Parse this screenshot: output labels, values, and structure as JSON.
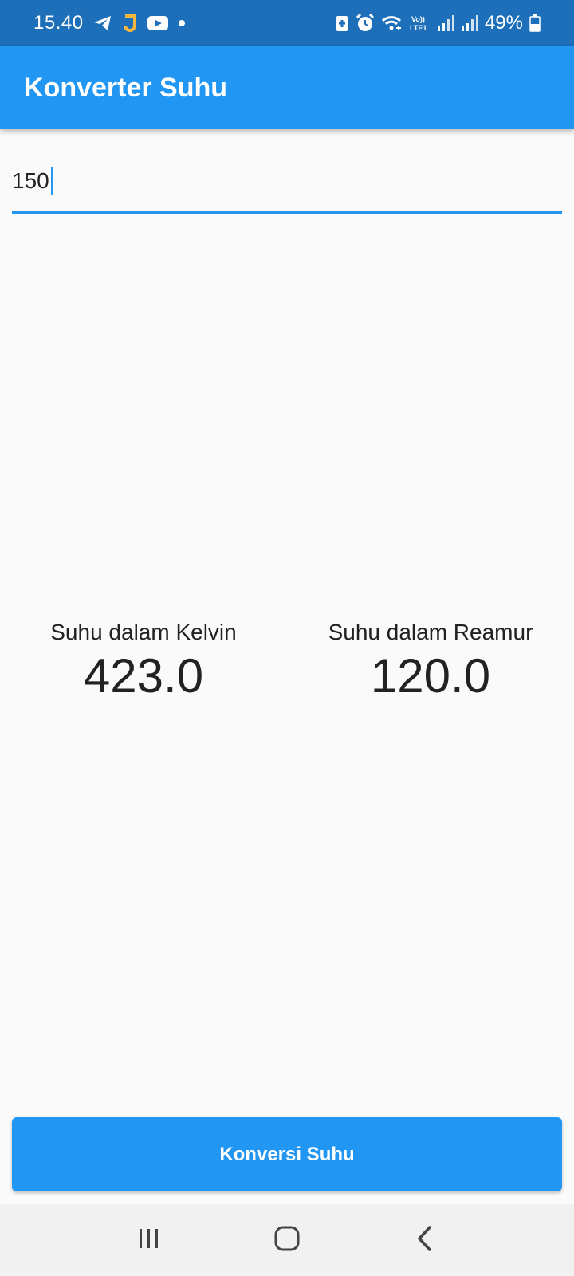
{
  "status_bar": {
    "time": "15.40",
    "battery": "49%",
    "icons": [
      "telegram-icon",
      "j-app-icon",
      "youtube-icon",
      "dot-icon",
      "battery-saver-icon",
      "alarm-icon",
      "wifi-icon",
      "volte-icon",
      "signal-icon",
      "signal-icon",
      "battery-icon"
    ]
  },
  "app_bar": {
    "title": "Konverter Suhu"
  },
  "input": {
    "value": "150"
  },
  "results": [
    {
      "label": "Suhu dalam Kelvin",
      "value": "423.0"
    },
    {
      "label": "Suhu dalam Reamur",
      "value": "120.0"
    }
  ],
  "button": {
    "label": "Konversi Suhu"
  },
  "nav": [
    "recents-icon",
    "home-icon",
    "back-icon"
  ],
  "colors": {
    "status_bar": "#1c6fb8",
    "primary": "#2196f3",
    "background": "#fafafa"
  }
}
